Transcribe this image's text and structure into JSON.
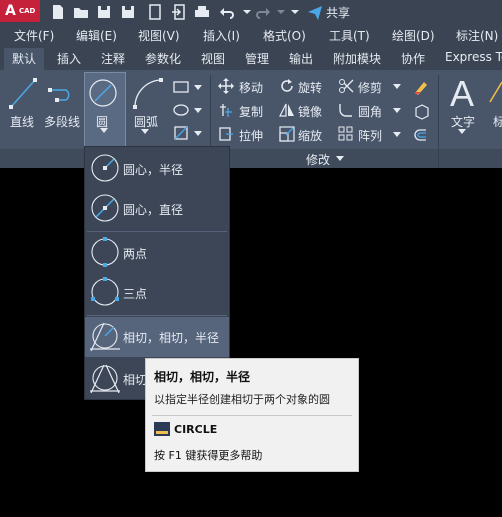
{
  "app": {
    "logo_letter": "A",
    "logo_suffix": "CAD",
    "share_label": "共享"
  },
  "menu": [
    {
      "label": "文件(F)"
    },
    {
      "label": "编辑(E)"
    },
    {
      "label": "视图(V)"
    },
    {
      "label": "插入(I)"
    },
    {
      "label": "格式(O)"
    },
    {
      "label": "工具(T)"
    },
    {
      "label": "绘图(D)"
    },
    {
      "label": "标注(N)"
    }
  ],
  "tabs": [
    {
      "label": "默认",
      "active": true
    },
    {
      "label": "插入"
    },
    {
      "label": "注释"
    },
    {
      "label": "参数化"
    },
    {
      "label": "视图"
    },
    {
      "label": "管理"
    },
    {
      "label": "输出"
    },
    {
      "label": "附加模块"
    },
    {
      "label": "协作"
    },
    {
      "label": "Express Tools"
    }
  ],
  "draw": {
    "line": "直线",
    "polyline": "多段线",
    "circle": "圆",
    "arc": "圆弧"
  },
  "modify": {
    "move": "移动",
    "rotate": "旋转",
    "trim": "修剪",
    "copy": "复制",
    "mirror": "镜像",
    "fillet": "圆角",
    "stretch": "拉伸",
    "scale": "缩放",
    "array": "阵列",
    "panel_title": "修改"
  },
  "annotation": {
    "text": "文字",
    "dim": "标"
  },
  "circle_menu": [
    {
      "label": "圆心，半径"
    },
    {
      "label": "圆心，直径"
    },
    {
      "label": "两点"
    },
    {
      "label": "三点"
    },
    {
      "label": "相切，相切，半径"
    },
    {
      "label": "相切，相切，相切"
    }
  ],
  "tooltip": {
    "title": "相切，相切，半径",
    "description": "以指定半径创建相切于两个对象的圆",
    "command": "CIRCLE",
    "help": "按 F1 键获得更多帮助"
  },
  "colors": {
    "ribbon": "#49566a",
    "bar": "#3b4453",
    "accent": "#4aa8e8",
    "logo": "#c6213a"
  }
}
